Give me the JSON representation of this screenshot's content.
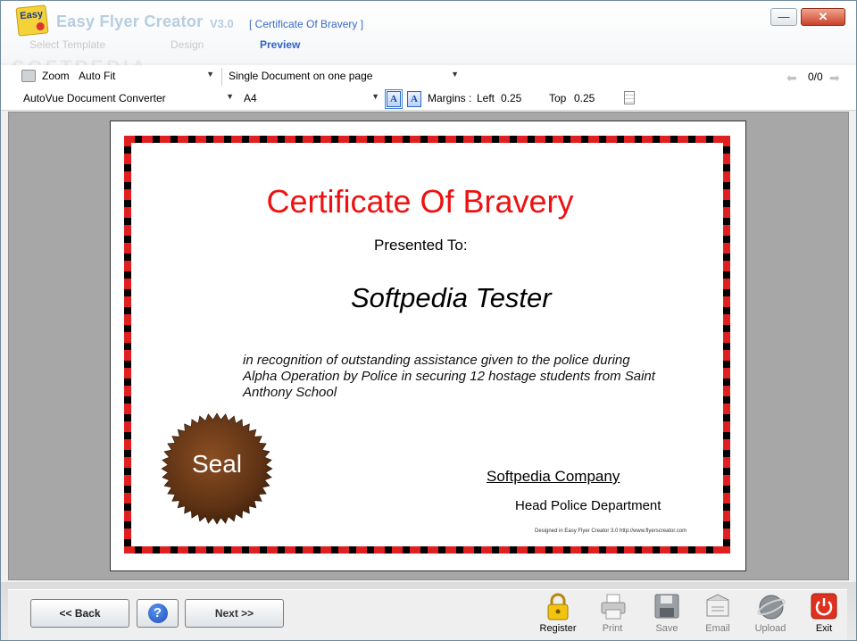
{
  "app": {
    "logo_text": "Easy",
    "name": "Easy Flyer Creator",
    "version": "V3.0",
    "document_title": "[ Certificate Of Bravery ]"
  },
  "steps": [
    "Select Template",
    "Design",
    "Preview"
  ],
  "toolbar": {
    "zoom_label": "Zoom",
    "zoom_value": "Auto Fit",
    "layout_value": "Single Document on one page",
    "printer_value": "AutoVue Document Converter",
    "paper_value": "A4",
    "margins_label": "Margins :",
    "left_label": "Left",
    "left_value": "0.25",
    "top_label": "Top",
    "top_value": "0.25",
    "page_count": "0/0",
    "portrait_icon": "A",
    "landscape_icon": "A"
  },
  "certificate": {
    "title": "Certificate Of Bravery",
    "presented": "Presented To:",
    "recipient": "Softpedia Tester",
    "recognition": "in recognition of outstanding assistance given to the police during Alpha Operation by Police in securing 12 hostage students from Saint Anthony School",
    "seal": "Seal",
    "company": "Softpedia Company",
    "department": "Head Police Department",
    "designed_by": "Designed in Easy Flyer Creator 3.0 http://www.flyerscreator.com"
  },
  "bottom": {
    "back": "<< Back",
    "help": "?",
    "next": "Next >>",
    "actions": [
      "Register",
      "Print",
      "Save",
      "Email",
      "Upload",
      "Exit"
    ]
  },
  "watermark": "SOFTPEDIA",
  "colors": {
    "title_red": "#ee1111",
    "active_step": "#2f62c9",
    "exit_red": "#e0301e"
  }
}
